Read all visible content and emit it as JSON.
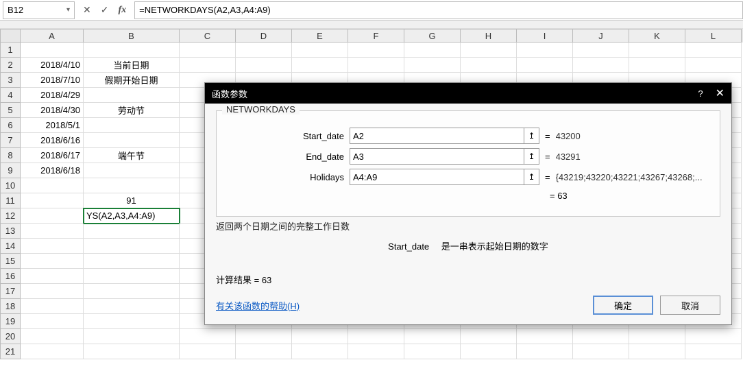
{
  "namebox": "B12",
  "formula": "=NETWORKDAYS(A2,A3,A4:A9)",
  "col_widths": {
    "A": 92,
    "B": 140,
    "others": 82
  },
  "columns": [
    "A",
    "B",
    "C",
    "D",
    "E",
    "F",
    "G",
    "H",
    "I",
    "J",
    "K",
    "L"
  ],
  "rows": 21,
  "cells": {
    "A2": "2018/4/10",
    "A3": "2018/7/10",
    "A4": "2018/4/29",
    "A5": "2018/4/30",
    "A6": "2018/5/1",
    "A7": "2018/6/16",
    "A8": "2018/6/17",
    "A9": "2018/6/18",
    "B2": "当前日期",
    "B3": "假期开始日期",
    "B5": "劳动节",
    "B8": "端午节",
    "B11": "91",
    "B12": "YS(A2,A3,A4:A9)"
  },
  "dialog": {
    "title": "函数参数",
    "func": "NETWORKDAYS",
    "args": [
      {
        "label": "Start_date",
        "input": "A2",
        "value": "43200"
      },
      {
        "label": "End_date",
        "input": "A3",
        "value": "43291"
      },
      {
        "label": "Holidays",
        "input": "A4:A9",
        "value": "{43219;43220;43221;43267;43268;..."
      }
    ],
    "inline_result": "= 63",
    "description": "返回两个日期之间的完整工作日数",
    "sub_label": "Start_date",
    "sub_text": "是一串表示起始日期的数字",
    "calc_prefix": "计算结果 = ",
    "calc_value": "63",
    "help": "有关该函数的帮助(H)",
    "ok": "确定",
    "cancel": "取消"
  }
}
